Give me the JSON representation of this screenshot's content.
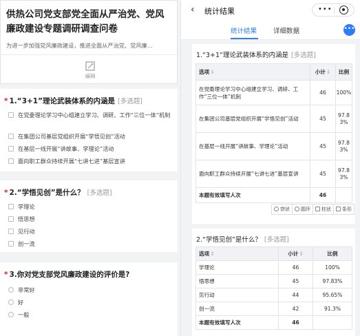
{
  "survey": {
    "title": "供热公司党支部党全面从严治党、党风廉政建设专题调研调查问卷",
    "description": "为进一步加强党风廉政建设，推进全面从严治党、党风廉…",
    "edit_label": "编辑"
  },
  "questions": [
    {
      "number": "1.",
      "title": "“3+1”理论武装体系的内涵是",
      "tag": "[多选题]",
      "type": "checkbox",
      "options": [
        "在党委理论学习中心组建立学习、调研、工作“三位一体”机制",
        "在集团公司基层党组织开展“学悟见创”活动",
        "在基层一线开展“讲故事、学理论”活动",
        "面向职工群众持续开展“七讲七进”基层宣讲"
      ]
    },
    {
      "number": "2.",
      "title": "“学悟见创”是什么？",
      "tag": "[多选题]",
      "type": "checkbox",
      "options": [
        "学理论",
        "悟思想",
        "见行动",
        "创一流"
      ]
    },
    {
      "number": "3.",
      "title": "你对党支部党风廉政建设的评价是?",
      "tag": "",
      "type": "radio",
      "options": [
        "非常好",
        "好",
        "一般"
      ]
    }
  ],
  "results_page": {
    "back_icon": "chevron-left-icon",
    "title": "统计结果",
    "capsule_more": "•••",
    "tabs": [
      {
        "label": "统计结果",
        "active": true
      },
      {
        "label": "详细数据",
        "active": false
      }
    ],
    "fab_label": "•••",
    "accent_color": "#2e7cf6"
  },
  "result_cards": [
    {
      "title": "1.“3+1”理论武装体系的内涵是",
      "tag": "[多选题]",
      "headers": [
        "选项",
        "小计",
        "比例"
      ],
      "rows": [
        {
          "option": "在党委理论学习中心组建立学习、调研、工作“三位一体”机制",
          "count": "46",
          "ratio": "100%"
        },
        {
          "option": "在集团公司基层党组织开展“学悟见创”活动",
          "count": "45",
          "ratio": "97.83%"
        },
        {
          "option": "在基层一线开展“讲故事、学理论”活动",
          "count": "45",
          "ratio": "97.83%"
        },
        {
          "option": "面向职工群众持续开展“七讲七进”基层宣讲",
          "count": "45",
          "ratio": "97.83%"
        }
      ],
      "total_label": "本题有效填写人次",
      "total_count": "46",
      "chart_tools": [
        "饼状",
        "圆环",
        "柱状",
        "条形"
      ]
    },
    {
      "title": "2.“学悟见创”是什么？",
      "tag": "[多选题]",
      "headers": [
        "选项",
        "小计",
        "比例"
      ],
      "rows": [
        {
          "option": "学理论",
          "count": "46",
          "ratio": "100%"
        },
        {
          "option": "悟思想",
          "count": "45",
          "ratio": "97.83%"
        },
        {
          "option": "见行动",
          "count": "44",
          "ratio": "95.65%"
        },
        {
          "option": "创一流",
          "count": "42",
          "ratio": "91.3%"
        }
      ],
      "total_label": "本题有效填写人次",
      "total_count": "46"
    }
  ]
}
